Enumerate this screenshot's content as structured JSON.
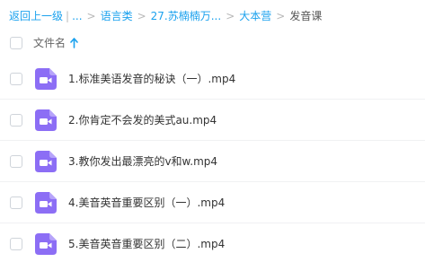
{
  "breadcrumb": {
    "back_label": "返回上一级",
    "ellipsis_label": "...",
    "items": [
      "语言类",
      "27.苏楠楠万...",
      "大本营"
    ],
    "current": "发音课"
  },
  "header": {
    "column_label": "文件名",
    "sort_direction": "ascending"
  },
  "files": [
    {
      "name": "1.标准美语发音的秘诀（一）.mp4"
    },
    {
      "name": "2.你肯定不会发的美式au.mp4"
    },
    {
      "name": "3.教你发出最漂亮的v和w.mp4"
    },
    {
      "name": "4.美音英音重要区别（一）.mp4"
    },
    {
      "name": "5.美音英音重要区别（二）.mp4"
    }
  ],
  "colors": {
    "link": "#1aa1ee",
    "video_icon": "#8c6ef5"
  }
}
